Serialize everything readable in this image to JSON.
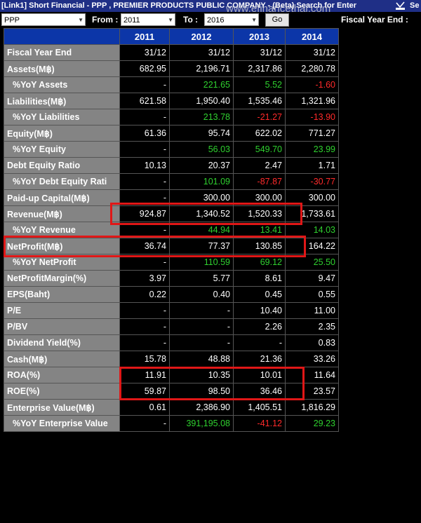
{
  "window": {
    "title": "[Link1] Short Financial - PPP , PREMIER PRODUCTS PUBLIC COMPANY - (Beta) Search for Enter",
    "corner": "Se"
  },
  "watermark": "www.efinancethai.com",
  "toolbar": {
    "symbol": "PPP",
    "from_label": "From :",
    "from_value": "2011",
    "to_label": "To :",
    "to_value": "2016",
    "go_label": "Go",
    "fiscal_label": "Fiscal Year End :"
  },
  "table": {
    "years": [
      "2011",
      "2012",
      "2013",
      "2014"
    ],
    "rows": [
      {
        "label": "Fiscal Year End",
        "indent": false,
        "values": [
          "31/12",
          "31/12",
          "31/12",
          "31/12"
        ],
        "tones": [
          "",
          "",
          "",
          ""
        ]
      },
      {
        "label": "Assets(M฿)",
        "indent": false,
        "values": [
          "682.95",
          "2,196.71",
          "2,317.86",
          "2,280.78"
        ],
        "tones": [
          "",
          "",
          "",
          ""
        ]
      },
      {
        "label": "%YoY Assets",
        "indent": true,
        "values": [
          "-",
          "221.65",
          "5.52",
          "-1.60"
        ],
        "tones": [
          "",
          "pos",
          "pos",
          "neg"
        ]
      },
      {
        "label": "Liabilities(M฿)",
        "indent": false,
        "values": [
          "621.58",
          "1,950.40",
          "1,535.46",
          "1,321.96"
        ],
        "tones": [
          "",
          "",
          "",
          ""
        ]
      },
      {
        "label": "%YoY Liabilities",
        "indent": true,
        "values": [
          "-",
          "213.78",
          "-21.27",
          "-13.90"
        ],
        "tones": [
          "",
          "pos",
          "neg",
          "neg"
        ]
      },
      {
        "label": "Equity(M฿)",
        "indent": false,
        "values": [
          "61.36",
          "95.74",
          "622.02",
          "771.27"
        ],
        "tones": [
          "",
          "",
          "",
          ""
        ]
      },
      {
        "label": "%YoY Equity",
        "indent": true,
        "values": [
          "-",
          "56.03",
          "549.70",
          "23.99"
        ],
        "tones": [
          "",
          "pos",
          "pos",
          "pos"
        ]
      },
      {
        "label": "Debt Equity Ratio",
        "indent": false,
        "values": [
          "10.13",
          "20.37",
          "2.47",
          "1.71"
        ],
        "tones": [
          "",
          "",
          "",
          ""
        ]
      },
      {
        "label": "%YoY Debt Equity Rati",
        "indent": true,
        "values": [
          "-",
          "101.09",
          "-87.87",
          "-30.77"
        ],
        "tones": [
          "",
          "pos",
          "neg",
          "neg"
        ]
      },
      {
        "label": "Paid-up Capital(M฿)",
        "indent": false,
        "values": [
          "-",
          "300.00",
          "300.00",
          "300.00"
        ],
        "tones": [
          "",
          "",
          "",
          ""
        ]
      },
      {
        "label": "Revenue(M฿)",
        "indent": false,
        "values": [
          "924.87",
          "1,340.52",
          "1,520.33",
          "1,733.61"
        ],
        "tones": [
          "",
          "",
          "",
          ""
        ]
      },
      {
        "label": "%YoY Revenue",
        "indent": true,
        "values": [
          "-",
          "44.94",
          "13.41",
          "14.03"
        ],
        "tones": [
          "",
          "pos",
          "pos",
          "pos"
        ]
      },
      {
        "label": "NetProfit(M฿)",
        "indent": false,
        "values": [
          "36.74",
          "77.37",
          "130.85",
          "164.22"
        ],
        "tones": [
          "",
          "",
          "",
          ""
        ]
      },
      {
        "label": "%YoY NetProfit",
        "indent": true,
        "values": [
          "-",
          "110.59",
          "69.12",
          "25.50"
        ],
        "tones": [
          "",
          "pos",
          "pos",
          "pos"
        ]
      },
      {
        "label": "NetProfitMargin(%)",
        "indent": false,
        "values": [
          "3.97",
          "5.77",
          "8.61",
          "9.47"
        ],
        "tones": [
          "",
          "",
          "",
          ""
        ]
      },
      {
        "label": "EPS(Baht)",
        "indent": false,
        "values": [
          "0.22",
          "0.40",
          "0.45",
          "0.55"
        ],
        "tones": [
          "",
          "",
          "",
          ""
        ]
      },
      {
        "label": "P/E",
        "indent": false,
        "values": [
          "-",
          "-",
          "10.40",
          "11.00"
        ],
        "tones": [
          "",
          "",
          "",
          ""
        ]
      },
      {
        "label": "P/BV",
        "indent": false,
        "values": [
          "-",
          "-",
          "2.26",
          "2.35"
        ],
        "tones": [
          "",
          "",
          "",
          ""
        ]
      },
      {
        "label": "Dividend Yield(%)",
        "indent": false,
        "values": [
          "-",
          "-",
          "-",
          "0.83"
        ],
        "tones": [
          "",
          "",
          "",
          ""
        ]
      },
      {
        "label": "Cash(M฿)",
        "indent": false,
        "values": [
          "15.78",
          "48.88",
          "21.36",
          "33.26"
        ],
        "tones": [
          "",
          "",
          "",
          ""
        ]
      },
      {
        "label": "ROA(%)",
        "indent": false,
        "values": [
          "11.91",
          "10.35",
          "10.01",
          "11.64"
        ],
        "tones": [
          "",
          "",
          "",
          ""
        ]
      },
      {
        "label": "ROE(%)",
        "indent": false,
        "values": [
          "59.87",
          "98.50",
          "36.46",
          "23.57"
        ],
        "tones": [
          "",
          "",
          "",
          ""
        ]
      },
      {
        "label": "Enterprise Value(M฿)",
        "indent": false,
        "values": [
          "0.61",
          "2,386.90",
          "1,405.51",
          "1,816.29"
        ],
        "tones": [
          "",
          "",
          "",
          ""
        ]
      },
      {
        "label": "%YoY Enterprise Value",
        "indent": true,
        "values": [
          "-",
          "391,195.08",
          "-41.12",
          "29.23"
        ],
        "tones": [
          "",
          "pos",
          "neg",
          "pos"
        ]
      }
    ]
  },
  "colors": {
    "header_blue": "#0c36a8",
    "label_gray": "#848484",
    "positive": "#2fd12f",
    "negative": "#ff2a2a",
    "highlight": "#e01717"
  },
  "highlights": [
    "Revenue(M฿)",
    "NetProfit(M฿)",
    "ROA(%)",
    "ROE(%)"
  ]
}
